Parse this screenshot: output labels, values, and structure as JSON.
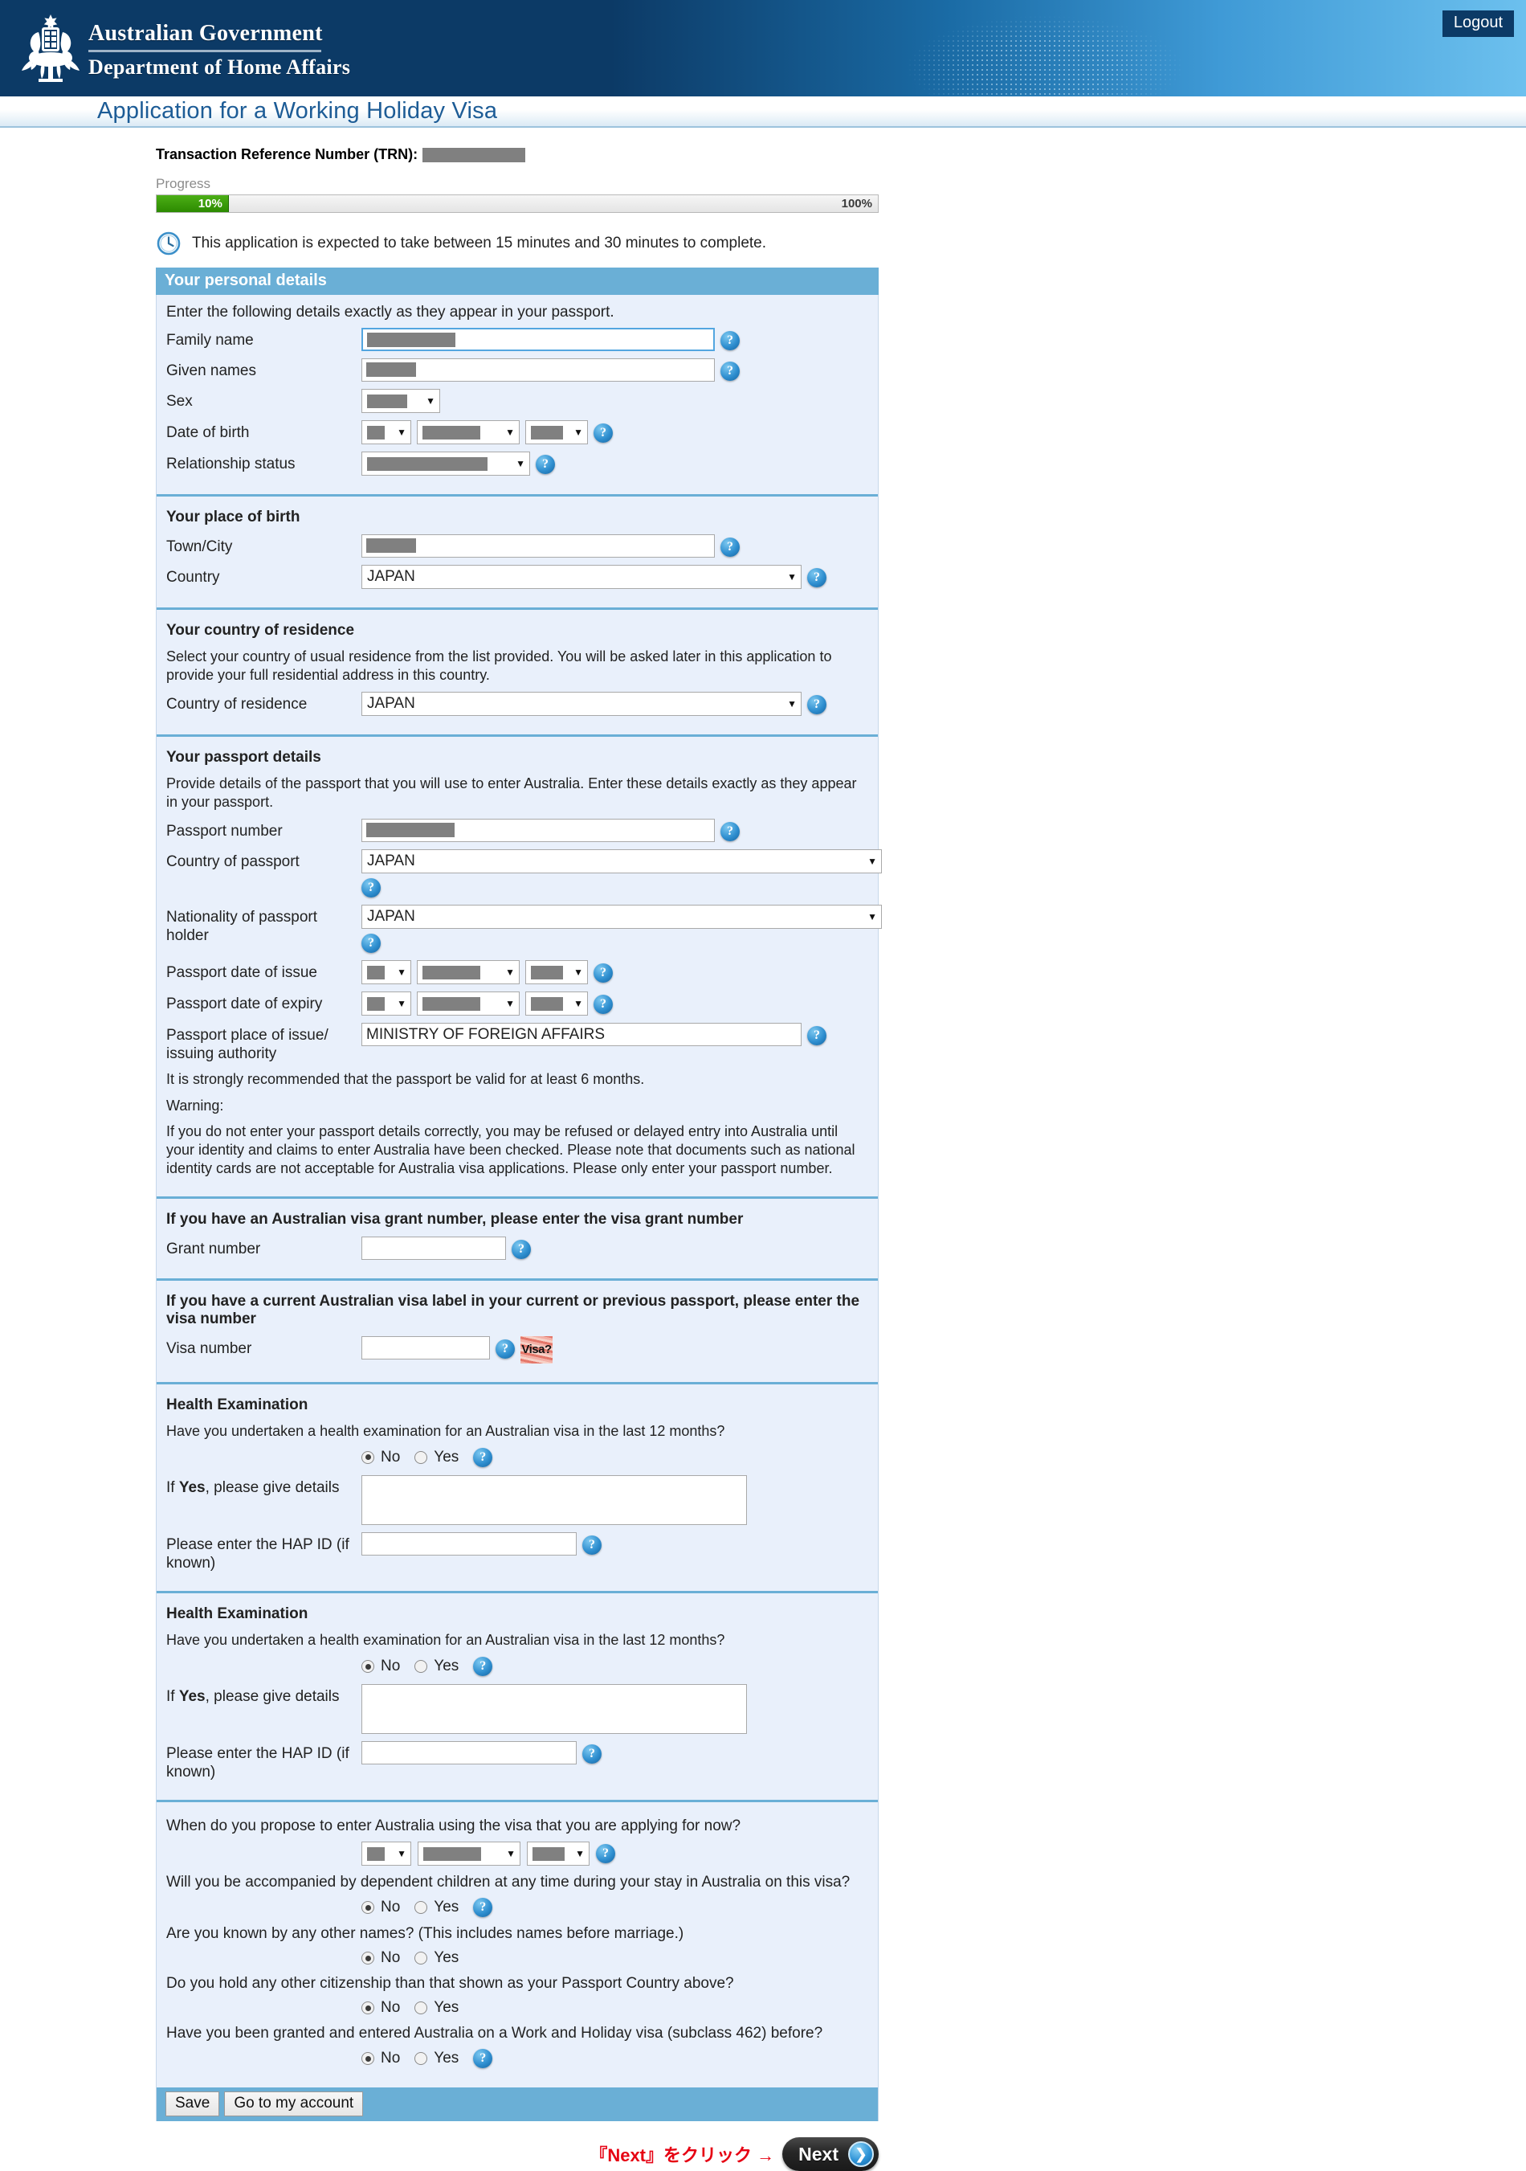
{
  "header": {
    "agency_line1": "Australian Government",
    "agency_line2": "Department of Home Affairs",
    "logout_label": "Logout",
    "page_title": "Application for a Working Holiday Visa"
  },
  "trn": {
    "label": "Transaction Reference Number (TRN):",
    "value_redacted": true
  },
  "progress": {
    "label": "Progress",
    "current": "10%",
    "max": "100%",
    "percent": 10
  },
  "notice": {
    "icon": "clock-icon",
    "text": "This application is expected to take between 15 minutes and 30 minutes to complete."
  },
  "personal": {
    "section_title": "Your personal details",
    "intro": "Enter the following details exactly as they appear in your passport.",
    "family_name_label": "Family name",
    "given_names_label": "Given names",
    "sex_label": "Sex",
    "dob_label": "Date of birth",
    "relationship_label": "Relationship status"
  },
  "place_of_birth": {
    "heading": "Your place of birth",
    "town_label": "Town/City",
    "country_label": "Country",
    "country_value": "JAPAN"
  },
  "residence": {
    "heading": "Your country of residence",
    "para": "Select your country of usual residence from the list provided. You will be asked later in this application to provide your full residential address in this country.",
    "label": "Country of residence",
    "value": "JAPAN"
  },
  "passport": {
    "heading": "Your passport details",
    "para": "Provide details of the passport that you will use to enter Australia. Enter these details exactly as they appear in your passport.",
    "number_label": "Passport number",
    "country_label": "Country of passport",
    "country_value": "JAPAN",
    "nationality_label": "Nationality of passport holder",
    "nationality_value": "JAPAN",
    "issue_label": "Passport date of issue",
    "expiry_label": "Passport date of expiry",
    "place_label": "Passport place of issue/ issuing authority",
    "place_value": "MINISTRY OF FOREIGN AFFAIRS",
    "recommend": "It is strongly recommended that the passport be valid for at least 6 months.",
    "warning_title": "Warning:",
    "warning_text": "If you do not enter your passport details correctly, you may be refused or delayed entry into Australia until your identity and claims to enter Australia have been checked. Please note that documents such as national identity cards are not acceptable for Australia visa applications. Please only enter your passport number."
  },
  "grant": {
    "heading": "If you have an Australian visa grant number, please enter the visa grant number",
    "label": "Grant number",
    "value": ""
  },
  "visa_label": {
    "heading": "If you have a current Australian visa label in your current or previous passport, please enter the visa number",
    "label": "Visa number",
    "value": "",
    "thumb_text": "Visa?"
  },
  "health": [
    {
      "heading": "Health Examination",
      "question": "Have you undertaken a health examination for an Australian visa in the last 12 months?",
      "no_label": "No",
      "yes_label": "Yes",
      "selected": "No",
      "details_label_prefix": "If ",
      "details_label_bold": "Yes",
      "details_label_suffix": ", please give details",
      "details_value": "",
      "hap_label": "Please enter the HAP ID (if known)",
      "hap_value": ""
    },
    {
      "heading": "Health Examination",
      "question": "Have you undertaken a health examination for an Australian visa in the last 12 months?",
      "no_label": "No",
      "yes_label": "Yes",
      "selected": "No",
      "details_label_prefix": "If ",
      "details_label_bold": "Yes",
      "details_label_suffix": ", please give details",
      "details_value": "",
      "hap_label": "Please enter the HAP ID (if known)",
      "hap_value": ""
    }
  ],
  "final_questions": {
    "entry_date_question": "When do you propose to enter Australia using the visa that you are applying for now?",
    "items": [
      {
        "question": "Will you be accompanied by dependent children at any time during your stay in Australia on this visa?",
        "no_label": "No",
        "yes_label": "Yes",
        "selected": "No",
        "has_help": true
      },
      {
        "question": "Are you known by any other names? (This includes names before marriage.)",
        "no_label": "No",
        "yes_label": "Yes",
        "selected": "No",
        "has_help": false
      },
      {
        "question": "Do you hold any other citizenship than that shown as your Passport Country above?",
        "no_label": "No",
        "yes_label": "Yes",
        "selected": "No",
        "has_help": false
      },
      {
        "question": "Have you been granted and entered Australia on a Work and Holiday visa (subclass 462) before?",
        "no_label": "No",
        "yes_label": "Yes",
        "selected": "No",
        "has_help": true
      }
    ]
  },
  "footer": {
    "save_label": "Save",
    "account_label": "Go to my account",
    "next_hint": "『Next』をクリック →",
    "next_label": "Next"
  },
  "colors": {
    "header_navy": "#0c3a66",
    "header_light_blue": "#6cc0ee",
    "section_blue": "#6aafd6",
    "panel_bg": "#e9f0fb",
    "progress_green": "#2c8a00",
    "title_blue": "#1d5c96",
    "hint_red": "#e60012"
  }
}
